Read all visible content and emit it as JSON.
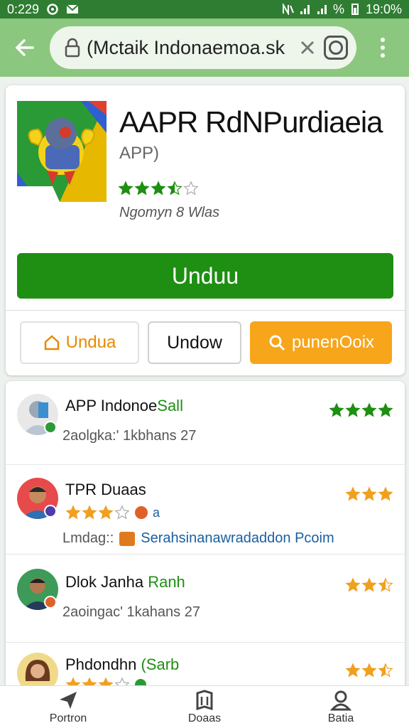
{
  "status_bar": {
    "time": "0:229",
    "battery": "19:0%",
    "signal": "%"
  },
  "url_bar": {
    "url": "(Mctaik Indonaemoa.sk",
    "back_icon": "arrow-left-icon",
    "menu_icon": "more-vert-icon"
  },
  "app": {
    "title": "AAPR RdNPurdiaeia",
    "subtitle": "APP)",
    "rating": 3.5,
    "developer": "Ngomyn 8 Wlas",
    "install_label": "Unduu",
    "buttons": {
      "a": "Undua",
      "b": "Undow",
      "c": "punenOoix"
    }
  },
  "reviews": [
    {
      "name": "APP Indonoe",
      "name_hl": "Sall",
      "meta": "2aolgka:'  1kbhans 27",
      "stars": 4,
      "star_color": "#1e8f12"
    },
    {
      "name": "TPR Duaas",
      "meta_label": "Lmdag::",
      "link": "Serahsinanawradaddon Pcoim",
      "stars": 3,
      "star_color": "#f0a020",
      "inline_stars": 3,
      "inline_suffix": "a"
    },
    {
      "name": "Dlok Janha",
      "name_hl": "Ranh",
      "meta": "2aoingac'  1kahans 27",
      "stars": 2.5,
      "star_color": "#f0a020"
    },
    {
      "name": "Phdondhn",
      "name_hl": "(Sarb",
      "stars": 2.5,
      "star_color": "#f0a020",
      "inline_stars": 3
    }
  ],
  "bottom_nav": [
    {
      "label": "Portron",
      "icon": "send-icon"
    },
    {
      "label": "Doaas",
      "icon": "book-icon"
    },
    {
      "label": "Batia",
      "icon": "person-icon"
    }
  ],
  "colors": {
    "primary": "#1e8f12",
    "toolbar": "#8cc77f",
    "statusbar": "#2f7d32",
    "accent": "#f7a51b"
  }
}
